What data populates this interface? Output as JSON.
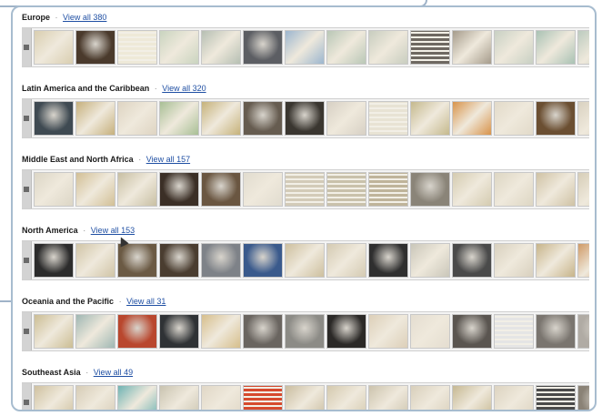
{
  "regions": [
    {
      "title": "Europe",
      "link": "View all 380",
      "thumbs": [
        {
          "kind": "map",
          "color": "#d9ceb0"
        },
        {
          "kind": "photo",
          "color": "#4a3a2c"
        },
        {
          "kind": "doc",
          "color": "#eee9d8"
        },
        {
          "kind": "map",
          "color": "#c9d4bf"
        },
        {
          "kind": "map",
          "color": "#b6bfb3"
        },
        {
          "kind": "photo",
          "color": "#5c5e63"
        },
        {
          "kind": "map",
          "color": "#9cb6cf"
        },
        {
          "kind": "map",
          "color": "#b9c7b6"
        },
        {
          "kind": "map",
          "color": "#c8cdbf"
        },
        {
          "kind": "doc",
          "color": "#6e6861"
        },
        {
          "kind": "map",
          "color": "#a59b8b"
        },
        {
          "kind": "map",
          "color": "#c8d0c3"
        },
        {
          "kind": "map",
          "color": "#a9c2b4"
        },
        {
          "kind": "map",
          "color": "#bccbbf"
        }
      ]
    },
    {
      "title": "Latin America and the Caribbean",
      "link": "View all 320",
      "thumbs": [
        {
          "kind": "photo",
          "color": "#3f4a52"
        },
        {
          "kind": "map",
          "color": "#c6b07c"
        },
        {
          "kind": "map",
          "color": "#ded4c2"
        },
        {
          "kind": "map",
          "color": "#a8bf95"
        },
        {
          "kind": "map",
          "color": "#c6b27a"
        },
        {
          "kind": "photo",
          "color": "#665c50"
        },
        {
          "kind": "photo",
          "color": "#3a3630"
        },
        {
          "kind": "map",
          "color": "#d7d0c4"
        },
        {
          "kind": "doc",
          "color": "#e8e3d4"
        },
        {
          "kind": "map",
          "color": "#c5b98d"
        },
        {
          "kind": "map",
          "color": "#d8934a"
        },
        {
          "kind": "map",
          "color": "#e2dac9"
        },
        {
          "kind": "photo",
          "color": "#6b4f32"
        },
        {
          "kind": "map",
          "color": "#d9d1c0"
        }
      ]
    },
    {
      "title": "Middle East and North Africa",
      "link": "View all 157",
      "thumbs": [
        {
          "kind": "map",
          "color": "#dcd6c6"
        },
        {
          "kind": "map",
          "color": "#d2bf95"
        },
        {
          "kind": "map",
          "color": "#c8bfa3"
        },
        {
          "kind": "photo",
          "color": "#3b2f26"
        },
        {
          "kind": "photo",
          "color": "#6a5641"
        },
        {
          "kind": "map",
          "color": "#e1dccf"
        },
        {
          "kind": "doc",
          "color": "#d3cbb8"
        },
        {
          "kind": "doc",
          "color": "#c9c1ab"
        },
        {
          "kind": "doc",
          "color": "#bfb49a"
        },
        {
          "kind": "photo",
          "color": "#8a8478"
        },
        {
          "kind": "map",
          "color": "#d4cbb0"
        },
        {
          "kind": "map",
          "color": "#ddd6c3"
        },
        {
          "kind": "map",
          "color": "#cfc2a4"
        },
        {
          "kind": "map",
          "color": "#d6cdb7"
        }
      ]
    },
    {
      "title": "North America",
      "link": "View all 153",
      "thumbs": [
        {
          "kind": "photo",
          "color": "#2c2c2c"
        },
        {
          "kind": "map",
          "color": "#d0c4a6"
        },
        {
          "kind": "photo",
          "color": "#6b5a44"
        },
        {
          "kind": "photo",
          "color": "#4a3d30"
        },
        {
          "kind": "photo",
          "color": "#7e8288"
        },
        {
          "kind": "photo",
          "color": "#3a5a8c"
        },
        {
          "kind": "map",
          "color": "#cdbf9e"
        },
        {
          "kind": "map",
          "color": "#d4cab2"
        },
        {
          "kind": "photo",
          "color": "#2f2f2f"
        },
        {
          "kind": "map",
          "color": "#c9c6b9"
        },
        {
          "kind": "photo",
          "color": "#4a4a4a"
        },
        {
          "kind": "map",
          "color": "#d8d0be"
        },
        {
          "kind": "map",
          "color": "#c7b48a"
        },
        {
          "kind": "map",
          "color": "#cf9a66"
        }
      ]
    },
    {
      "title": "Oceania and the Pacific",
      "link": "View all 31",
      "thumbs": [
        {
          "kind": "map",
          "color": "#cbbd94"
        },
        {
          "kind": "map",
          "color": "#9fb7b3"
        },
        {
          "kind": "photo",
          "color": "#b9472e"
        },
        {
          "kind": "photo",
          "color": "#2f3235"
        },
        {
          "kind": "map",
          "color": "#d6be8c"
        },
        {
          "kind": "photo",
          "color": "#6a6560"
        },
        {
          "kind": "photo",
          "color": "#8c8b86"
        },
        {
          "kind": "photo",
          "color": "#2b2927"
        },
        {
          "kind": "map",
          "color": "#dccfb8"
        },
        {
          "kind": "map",
          "color": "#e4ddd0"
        },
        {
          "kind": "photo",
          "color": "#5a5550"
        },
        {
          "kind": "doc",
          "color": "#e5e5e5"
        },
        {
          "kind": "photo",
          "color": "#7a756f"
        },
        {
          "kind": "photo",
          "color": "#b0aba4"
        }
      ]
    },
    {
      "title": "Southeast Asia",
      "link": "View all 49",
      "thumbs": [
        {
          "kind": "map",
          "color": "#cfc1a0"
        },
        {
          "kind": "map",
          "color": "#d6ccb6"
        },
        {
          "kind": "map",
          "color": "#6fb3b3"
        },
        {
          "kind": "map",
          "color": "#c9c3b0"
        },
        {
          "kind": "map",
          "color": "#e0d7c6"
        },
        {
          "kind": "doc",
          "color": "#d64a2e"
        },
        {
          "kind": "map",
          "color": "#cabda0"
        },
        {
          "kind": "map",
          "color": "#d4c9ae"
        },
        {
          "kind": "map",
          "color": "#ccc3ad"
        },
        {
          "kind": "map",
          "color": "#d8cfbb"
        },
        {
          "kind": "map",
          "color": "#c6b892"
        },
        {
          "kind": "map",
          "color": "#dcd3c0"
        },
        {
          "kind": "doc",
          "color": "#4a4a4a"
        },
        {
          "kind": "photo",
          "color": "#8a8276"
        }
      ]
    }
  ]
}
